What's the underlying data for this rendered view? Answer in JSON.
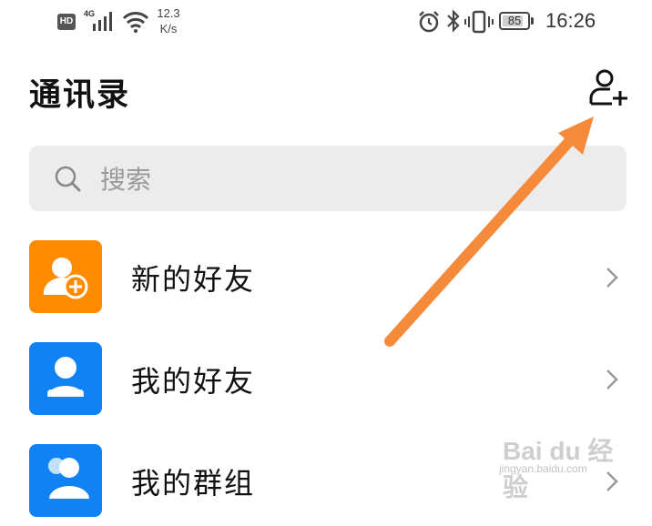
{
  "status_bar": {
    "hd": "HD",
    "network": "4G",
    "speed_value": "12.3",
    "speed_unit": "K/s",
    "battery": "85",
    "battery_level": 0.85,
    "time": "16:26"
  },
  "header": {
    "title": "通讯录",
    "add_icon": "add-user-icon"
  },
  "search": {
    "placeholder": "搜索",
    "value": ""
  },
  "list": [
    {
      "label": "新的好友",
      "icon": "new-friend-icon",
      "color": "#ff8c00"
    },
    {
      "label": "我的好友",
      "icon": "my-friends-icon",
      "color": "#1182f4"
    },
    {
      "label": "我的群组",
      "icon": "my-groups-icon",
      "color": "#1182f4"
    }
  ],
  "watermark": {
    "logo": "Bai du 经验",
    "url": "jingyan.baidu.com"
  },
  "colors": {
    "orange_accent": "#ff8c00",
    "blue_accent": "#1182f4",
    "arrow": "#f58a3a",
    "search_bg": "#ececed"
  }
}
